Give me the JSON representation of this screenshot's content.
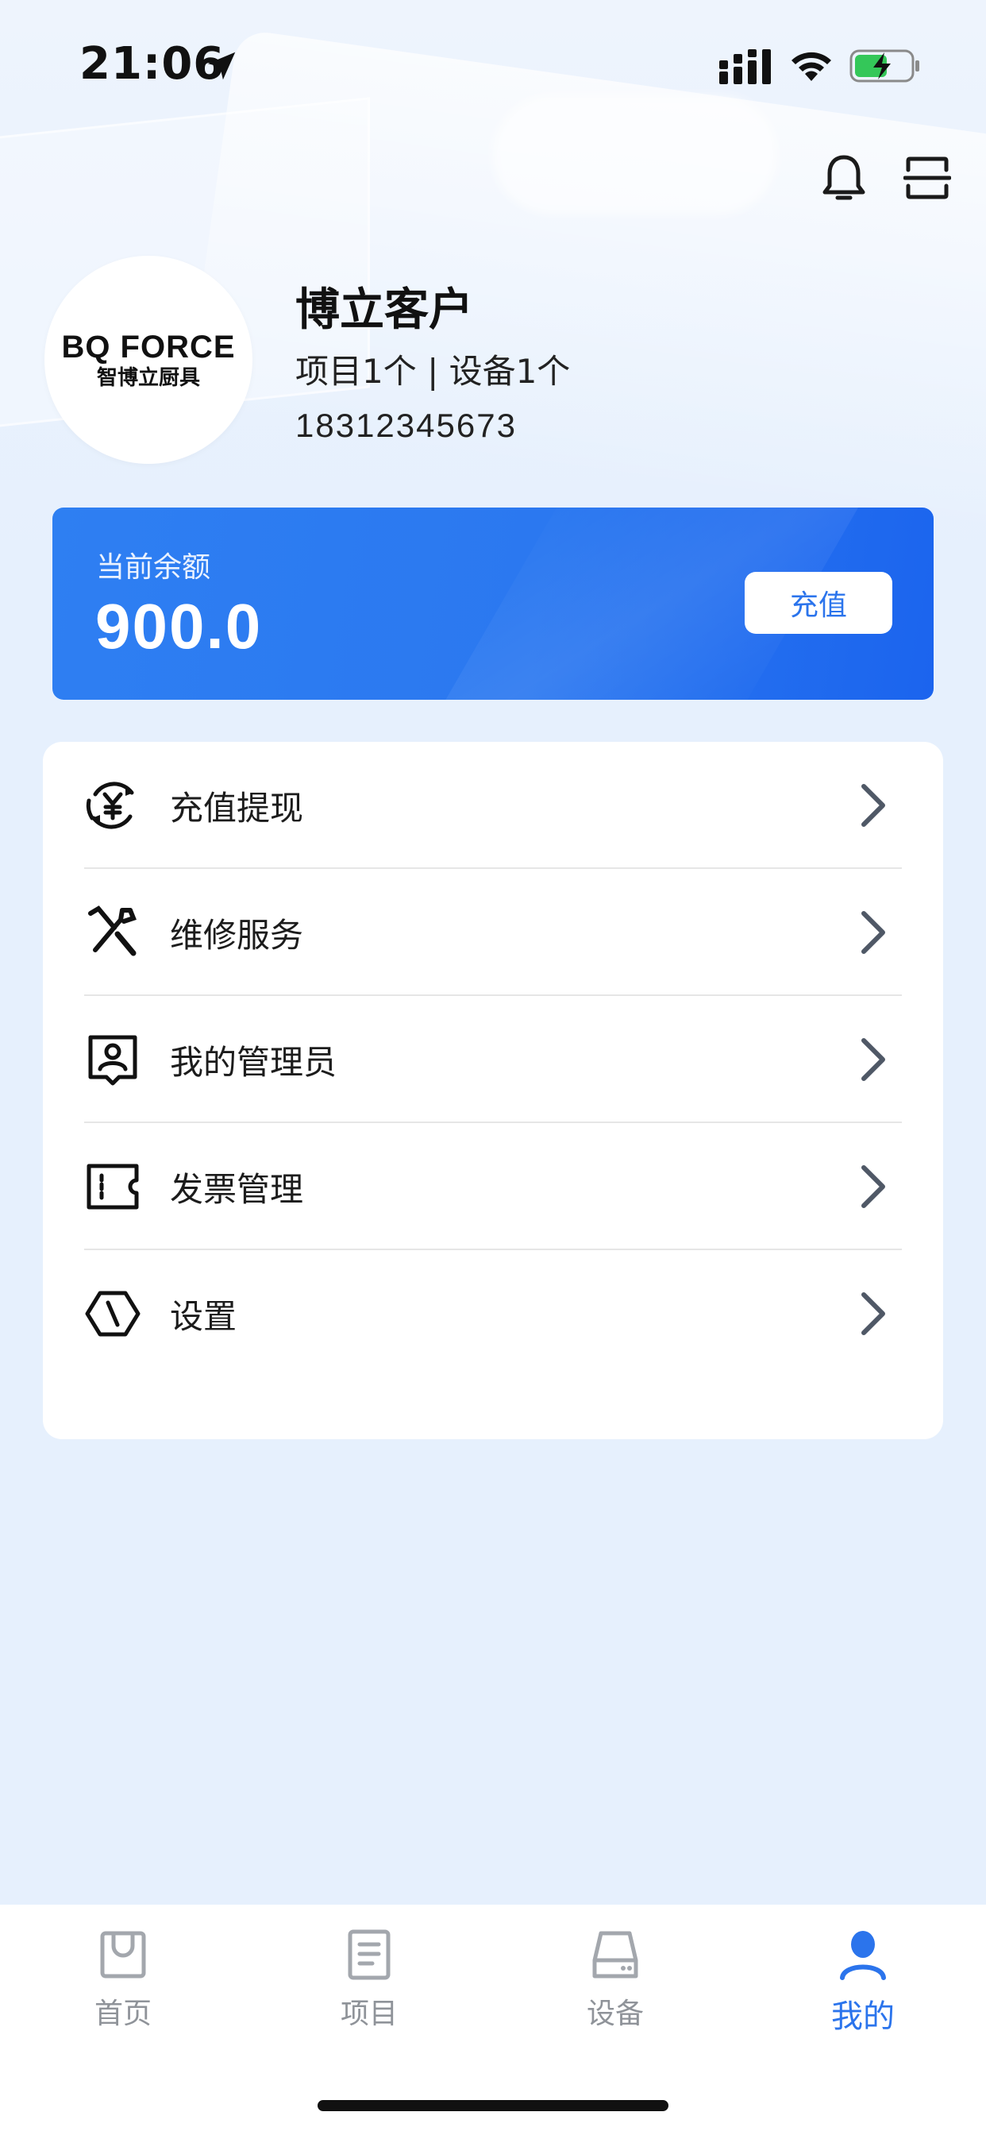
{
  "status_bar": {
    "time": "21:06"
  },
  "profile": {
    "name": "博立客户",
    "stats": "项目1个 | 设备1个",
    "phone": "18312345673",
    "avatar_logo_main": "BQ FORCE",
    "avatar_logo_sub": "智博立厨具"
  },
  "balance": {
    "label": "当前余额",
    "value": "900.0",
    "recharge_label": "充值"
  },
  "menu": {
    "items": [
      {
        "label": "充值提现",
        "icon": "yen-cycle-icon"
      },
      {
        "label": "维修服务",
        "icon": "tools-icon"
      },
      {
        "label": "我的管理员",
        "icon": "admin-badge-icon"
      },
      {
        "label": "发票管理",
        "icon": "ticket-icon"
      },
      {
        "label": "设置",
        "icon": "hexagon-settings-icon"
      }
    ]
  },
  "tabs": [
    {
      "label": "首页",
      "icon": "bag-icon",
      "active": false
    },
    {
      "label": "项目",
      "icon": "document-icon",
      "active": false
    },
    {
      "label": "设备",
      "icon": "device-icon",
      "active": false
    },
    {
      "label": "我的",
      "icon": "user-icon",
      "active": true
    }
  ],
  "colors": {
    "accent": "#2b74ec",
    "card_blue": "#2e7ff2",
    "background": "#e6f0fd",
    "tab_inactive": "#8f9399"
  }
}
